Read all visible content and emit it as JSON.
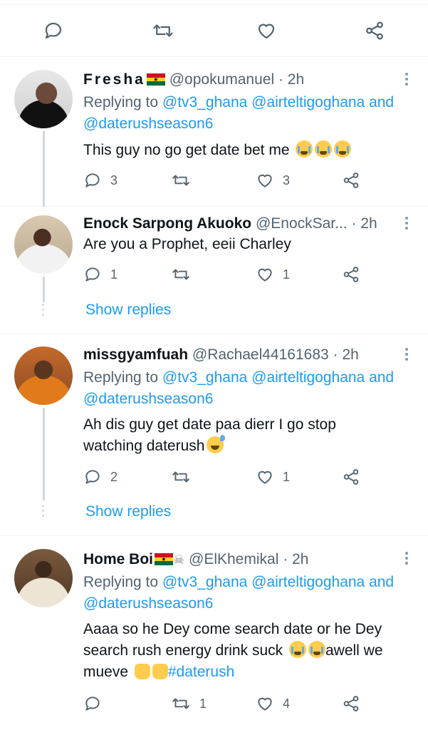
{
  "top_actions": {
    "icons": [
      "reply-icon",
      "retweet-icon",
      "like-icon",
      "share-icon"
    ]
  },
  "tweets": [
    {
      "name": "Fresha",
      "handle": "@opokumanuel",
      "time": "· 2h",
      "replying_prefix": "Replying to",
      "mentions_line1": "@tv3_ghana @airteltigoghana and",
      "mentions_line2": "@daterushseason6",
      "text": "This guy no go get date bet me",
      "reply_count": "3",
      "retweet_count": "",
      "like_count": "3"
    },
    {
      "name": "Enock Sarpong Akuoko",
      "handle": "@EnockSar...",
      "time": "· 2h",
      "text": "Are you a Prophet, eeii Charley",
      "reply_count": "1",
      "retweet_count": "",
      "like_count": "1",
      "show_replies": "Show replies"
    },
    {
      "name": "missgyamfuah",
      "handle": "@Rachael44161683",
      "time": "· 2h",
      "replying_prefix": "Replying to",
      "mentions_line1": "@tv3_ghana @airteltigoghana and",
      "mentions_line2": "@daterushseason6",
      "text_line1": "Ah dis guy get date paa dierr I go stop",
      "text_line2": "watching daterush",
      "reply_count": "2",
      "retweet_count": "",
      "like_count": "1",
      "show_replies": "Show replies"
    },
    {
      "name": "Home Boi",
      "handle": "@ElKhemikal",
      "time": "· 2h",
      "replying_prefix": "Replying to",
      "mentions_line1": "@tv3_ghana @airteltigoghana and",
      "mentions_line2": "@daterushseason6",
      "text_line1": "Aaaa so he Dey come search date or he Dey",
      "text_line2a": "search rush energy drink suck",
      "text_line2b": "awell we",
      "text_line3a": "mueve",
      "hashtag": "#daterush",
      "reply_count": "",
      "retweet_count": "1",
      "like_count": "4"
    }
  ],
  "colors": {
    "link": "#1d9bf0",
    "muted": "#536471",
    "thread_line": "#cfd9de",
    "ghana_red": "#ce1126",
    "ghana_gold": "#fcd116",
    "ghana_green": "#006b3f"
  }
}
